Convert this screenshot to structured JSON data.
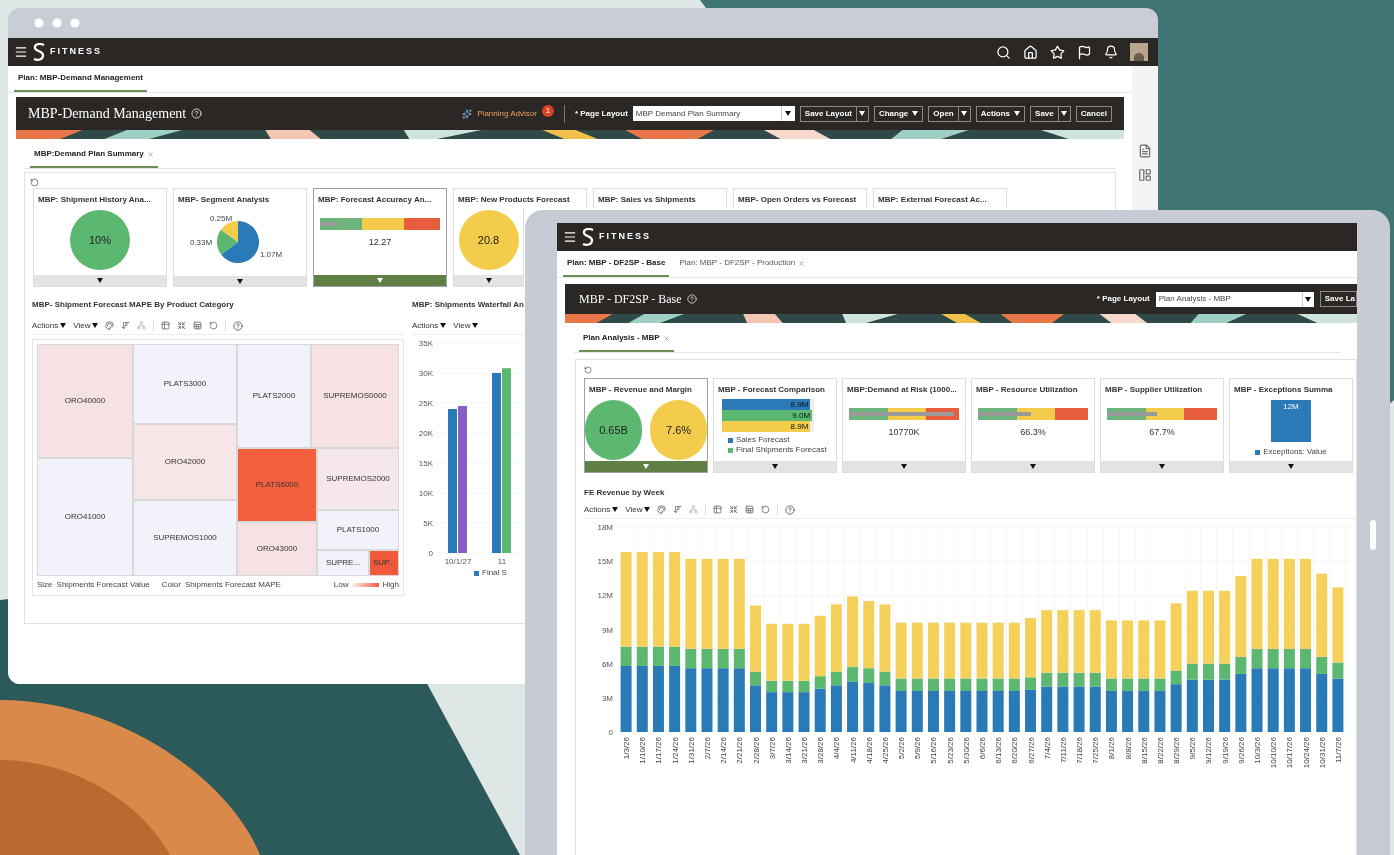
{
  "desktop_window": {
    "brand": "FITNESS",
    "plan_tabs": [
      {
        "label": "Plan: MBP-Demand Management",
        "selected": true,
        "closable": false
      }
    ],
    "header": {
      "title": "MBP-Demand Management",
      "advisor": "Planning Advisor",
      "advisor_badge": "1",
      "layout_label": "* Page Layout",
      "layout_value": "MBP Demand Plan Summary",
      "buttons": [
        {
          "label": "Save Layout",
          "kind": "split"
        },
        {
          "label": "Change",
          "kind": "menu"
        },
        {
          "label": "Open",
          "kind": "split"
        },
        {
          "label": "Actions",
          "kind": "menu"
        },
        {
          "label": "Save",
          "kind": "split"
        },
        {
          "label": "Cancel",
          "kind": "plain"
        }
      ]
    },
    "doc_tabs": [
      {
        "label": "MBP:Demand Plan Summary",
        "selected": true,
        "closable": true
      }
    ],
    "tiles": [
      {
        "title": "MBP: Shipment History Ana...",
        "kind": "circle",
        "selected": false,
        "circles": [
          {
            "value": "10%",
            "color": "#5cb870"
          }
        ]
      },
      {
        "title": "MBP- Segment Analysis",
        "kind": "pie",
        "selected": false,
        "chart_data": {
          "type": "pie",
          "values": [
            1.07,
            0.33,
            0.25
          ],
          "value_labels": [
            "1.07M",
            "0.33M",
            "0.25M"
          ]
        }
      },
      {
        "title": "MBP: Forecast Accuracy An...",
        "kind": "meter",
        "selected": true,
        "level": 0.15,
        "value": "12.27"
      },
      {
        "title": "MBP: New Products Forecast",
        "kind": "circle",
        "selected": false,
        "circles": [
          {
            "value": "20.8",
            "color": "#f2cc4a"
          }
        ]
      },
      {
        "title": "MBP: Sales vs Shipments",
        "kind": "empty"
      },
      {
        "title": "MBP- Open Orders vs Forecast",
        "kind": "empty"
      },
      {
        "title": "MBP: External Forecast Ac...",
        "kind": "empty"
      }
    ],
    "treemap": {
      "title": "MBP- Shipment Forecast MAPE By Product Category",
      "toolbar": [
        "Actions",
        "View"
      ],
      "cells": [
        {
          "label": "ORO40000",
          "color": "#f6e2e4"
        },
        {
          "label": "ORO41000",
          "color": "#f2f3fa"
        },
        {
          "label": "PLATS3000",
          "color": "#f2f3fa"
        },
        {
          "label": "ORO42000",
          "color": "#f6e6e8"
        },
        {
          "label": "SUPREMOS1000",
          "color": "#f2f3fa"
        },
        {
          "label": "PLATS2000",
          "color": "#f2f3fa"
        },
        {
          "label": "SUPREMOS0000",
          "color": "#f6e2e4"
        },
        {
          "label": "PLATS6000",
          "color": "#f4603e"
        },
        {
          "label": "ORO43000",
          "color": "#f6e2e4"
        },
        {
          "label": "SUPREMOS2000",
          "color": "#f6e8ea"
        },
        {
          "label": "PLATS1000",
          "color": "#f2f3fa"
        },
        {
          "label": "SUPRE...",
          "color": "#f2f3fa"
        },
        {
          "label": "SUP...",
          "color": "#f05a3a"
        }
      ],
      "size_label": "Size",
      "size_value": "Shipments Forecast Value",
      "color_label": "Color",
      "color_value": "Shipments Forecast MAPE",
      "low": "Low",
      "high": "High"
    },
    "waterfall": {
      "title": "MBP: Shipments Waterfall An",
      "toolbar": [
        "Actions",
        "View"
      ],
      "legend": "Final S",
      "chart_data": {
        "type": "bar",
        "categories": [
          "10/1/27",
          "11"
        ],
        "ylim": [
          0,
          35000
        ],
        "yticks": [
          {
            "value": 0,
            "label": "0"
          },
          {
            "value": 5000,
            "label": "5K"
          },
          {
            "value": 10000,
            "label": "10K"
          },
          {
            "value": 15000,
            "label": "15K"
          },
          {
            "value": 20000,
            "label": "20K"
          },
          {
            "value": 25000,
            "label": "25K"
          },
          {
            "value": 30000,
            "label": "30K"
          },
          {
            "value": 35000,
            "label": "35K"
          }
        ],
        "series": [
          {
            "color": "#2a7ab8",
            "values": [
              24000,
              30000
            ]
          },
          {
            "color": "#8a5cc8",
            "values": [
              24500,
              null
            ]
          },
          {
            "color": "#5cb870",
            "values": [
              null,
              30800
            ]
          }
        ]
      }
    }
  },
  "tablet_window": {
    "brand": "FITNESS",
    "plan_tabs": [
      {
        "label": "Plan: MBP - DF2SP - Base",
        "selected": true,
        "closable": false
      },
      {
        "label": "Plan: MBP - DF2SP - Production",
        "selected": false,
        "closable": true
      }
    ],
    "header": {
      "title": "MBP - DF2SP - Base",
      "layout_label": "* Page Layout",
      "layout_value": "Plan Analysis - MBP",
      "button": "Save La"
    },
    "doc_tabs": [
      {
        "label": "Plan Analysis - MBP",
        "selected": true,
        "closable": true
      }
    ],
    "tiles": [
      {
        "title": "MBP - Revenue and Margin",
        "kind": "circle",
        "selected": true,
        "circles": [
          {
            "value": "0.65B",
            "color": "#5cb870"
          },
          {
            "value": "7.6%",
            "color": "#f2cc4a"
          }
        ]
      },
      {
        "title": "MBP - Forecast Comparison",
        "kind": "hbars",
        "selected": false,
        "bars": [
          {
            "label": "8.9M",
            "level": 0.96,
            "color": "#2a7ab8"
          },
          {
            "label": "9.0M",
            "level": 0.98,
            "color": "#5cb870"
          },
          {
            "label": "8.9M",
            "level": 0.96,
            "color": "#f2cc4a"
          }
        ],
        "legend": [
          {
            "label": "Sales Forecast",
            "color": "#2a7ab8"
          },
          {
            "label": "Final Shipments Forecast",
            "color": "#5cb870"
          }
        ]
      },
      {
        "title": "MBP:Demand at Risk (1000...",
        "kind": "meter",
        "selected": false,
        "level": 0.95,
        "value": "10770K"
      },
      {
        "title": "MBP - Resource Utilization",
        "kind": "meter",
        "selected": false,
        "level": 0.48,
        "value": "66.3%"
      },
      {
        "title": "MBP - Supplier Utilization",
        "kind": "meter",
        "selected": false,
        "level": 0.45,
        "value": "67.7%"
      },
      {
        "title": "MBP - Exceptions Summa",
        "kind": "column",
        "selected": false,
        "value": "12M",
        "legend": "Exceptions: Value",
        "color": "#2a7ab8"
      }
    ],
    "chart": {
      "title": "FE Revenue by Week",
      "toolbar": [
        "Actions",
        "View"
      ],
      "chart_data": {
        "type": "bar",
        "stacked": true,
        "grid": true,
        "ylim": [
          0,
          18
        ],
        "yticks": [
          {
            "value": 0,
            "label": "0"
          },
          {
            "value": 3,
            "label": "3M"
          },
          {
            "value": 6,
            "label": "6M"
          },
          {
            "value": 9,
            "label": "9M"
          },
          {
            "value": 12,
            "label": "12M"
          },
          {
            "value": 15,
            "label": "15M"
          },
          {
            "value": 18,
            "label": "18M"
          }
        ],
        "categories": [
          "1/3/26",
          "1/10/26",
          "1/17/26",
          "1/24/26",
          "1/31/26",
          "2/7/26",
          "2/14/26",
          "2/21/26",
          "2/28/26",
          "3/7/26",
          "3/14/26",
          "3/21/26",
          "3/28/26",
          "4/4/26",
          "4/11/26",
          "4/18/26",
          "4/25/26",
          "5/2/26",
          "5/9/26",
          "5/16/26",
          "5/23/26",
          "5/30/26",
          "6/6/26",
          "6/13/26",
          "6/20/26",
          "6/27/26",
          "7/4/26",
          "7/11/26",
          "7/18/26",
          "7/25/26",
          "8/1/26",
          "8/8/26",
          "8/15/26",
          "8/22/26",
          "8/29/26",
          "9/5/26",
          "9/12/26",
          "9/19/26",
          "9/26/26",
          "10/3/26",
          "10/10/26",
          "10/17/26",
          "10/24/26",
          "10/31/26",
          "11/7/26"
        ],
        "series": [
          {
            "color": "#2a7ab8",
            "values": [
              5.8,
              5.8,
              5.8,
              5.8,
              5.6,
              5.6,
              5.6,
              5.6,
              4.1,
              3.5,
              3.5,
              3.5,
              3.8,
              4.1,
              4.4,
              4.3,
              4.1,
              3.6,
              3.6,
              3.6,
              3.6,
              3.6,
              3.6,
              3.6,
              3.6,
              3.7,
              4.0,
              4.0,
              4.0,
              4.0,
              3.6,
              3.6,
              3.6,
              3.6,
              4.2,
              4.6,
              4.6,
              4.6,
              5.1,
              5.6,
              5.6,
              5.6,
              5.6,
              5.1,
              4.7
            ]
          },
          {
            "color": "#5cb870",
            "values": [
              1.7,
              1.7,
              1.7,
              1.7,
              1.7,
              1.7,
              1.7,
              1.7,
              1.2,
              1.0,
              1.0,
              1.0,
              1.1,
              1.2,
              1.3,
              1.3,
              1.2,
              1.1,
              1.1,
              1.1,
              1.1,
              1.1,
              1.1,
              1.1,
              1.1,
              1.1,
              1.2,
              1.2,
              1.2,
              1.2,
              1.1,
              1.1,
              1.1,
              1.1,
              1.2,
              1.4,
              1.4,
              1.4,
              1.5,
              1.7,
              1.7,
              1.7,
              1.7,
              1.5,
              1.4
            ]
          },
          {
            "color": "#f5d05a",
            "values": [
              8.3,
              8.3,
              8.3,
              8.3,
              7.9,
              7.9,
              7.9,
              7.9,
              5.8,
              5.0,
              5.0,
              5.0,
              5.3,
              5.9,
              6.2,
              5.9,
              5.9,
              4.9,
              4.9,
              4.9,
              4.9,
              4.9,
              4.9,
              4.9,
              4.9,
              5.2,
              5.5,
              5.5,
              5.5,
              5.5,
              5.1,
              5.1,
              5.1,
              5.1,
              5.9,
              6.4,
              6.4,
              6.4,
              7.1,
              7.9,
              7.9,
              7.9,
              7.9,
              7.3,
              6.6
            ]
          }
        ]
      }
    }
  }
}
